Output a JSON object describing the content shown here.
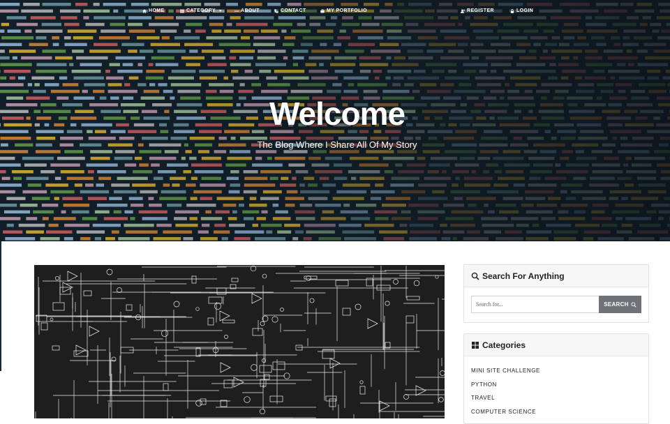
{
  "nav": {
    "items": [
      {
        "label": "HOME",
        "icon": "home-icon"
      },
      {
        "label": "CATEGORY",
        "icon": "list-icon",
        "has_dropdown": true
      },
      {
        "label": "ABOUT",
        "icon": "dots-icon"
      },
      {
        "label": "CONTACT",
        "icon": "phone-icon"
      },
      {
        "label": "MY PORTFOLIO",
        "icon": "briefcase-icon"
      },
      {
        "label": "REGISTER",
        "icon": "user-plus-icon"
      },
      {
        "label": "LOGIN",
        "icon": "lock-icon"
      }
    ]
  },
  "hero": {
    "title": "Welcome",
    "subtitle": "The Blog Where I Share All Of My Story"
  },
  "search_widget": {
    "title": "Search For Anything",
    "placeholder": "Search for...",
    "button_label": "SEARCH"
  },
  "categories_widget": {
    "title": "Categories",
    "items": [
      "MINI SITE CHALLENGE",
      "PYTHON",
      "TRAVEL",
      "COMPUTER SCIENCE"
    ]
  },
  "colors": {
    "hero_bg": "#0f1a22",
    "search_button": "#6f7276",
    "widget_header": "#f7f7f7"
  }
}
